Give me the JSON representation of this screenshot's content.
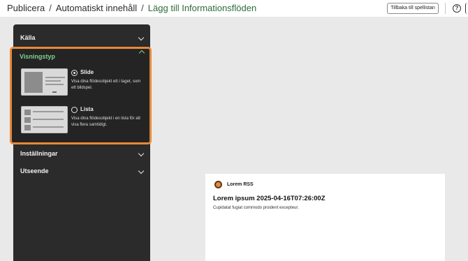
{
  "header": {
    "breadcrumb": [
      "Publicera",
      "Automatiskt innehåll",
      "Lägg till Informationsflöden"
    ],
    "separator": "/",
    "back_button_label": "Tillbaka till spellistan",
    "help_icon": "help-circle-icon",
    "help_glyph": "?"
  },
  "sidebar": {
    "sections": [
      {
        "label": "Källa",
        "expanded": false
      },
      {
        "label": "Visningstyp",
        "expanded": true
      },
      {
        "label": "Inställningar",
        "expanded": false
      },
      {
        "label": "Utseende",
        "expanded": false
      }
    ],
    "display_options": [
      {
        "label": "Slide",
        "description": "Visa dina flödesobjekt ett i taget, som ett bildspel.",
        "selected": true
      },
      {
        "label": "Lista",
        "description": "Visa dina flödesobjekt i en lista för att visa flera samtidigt.",
        "selected": false
      }
    ]
  },
  "preview": {
    "feed_name": "Lorem RSS",
    "item_title": "Lorem ipsum 2025-04-16T07:26:00Z",
    "item_text": "Cupidatat fugiat commodo proident excepteur."
  },
  "colors": {
    "accent_orange": "#e8893a",
    "active_green": "#7fd18d",
    "breadcrumb_green": "#2f6b3a",
    "panel_bg": "#2b2b2b",
    "page_bg": "#e9e9e9"
  }
}
